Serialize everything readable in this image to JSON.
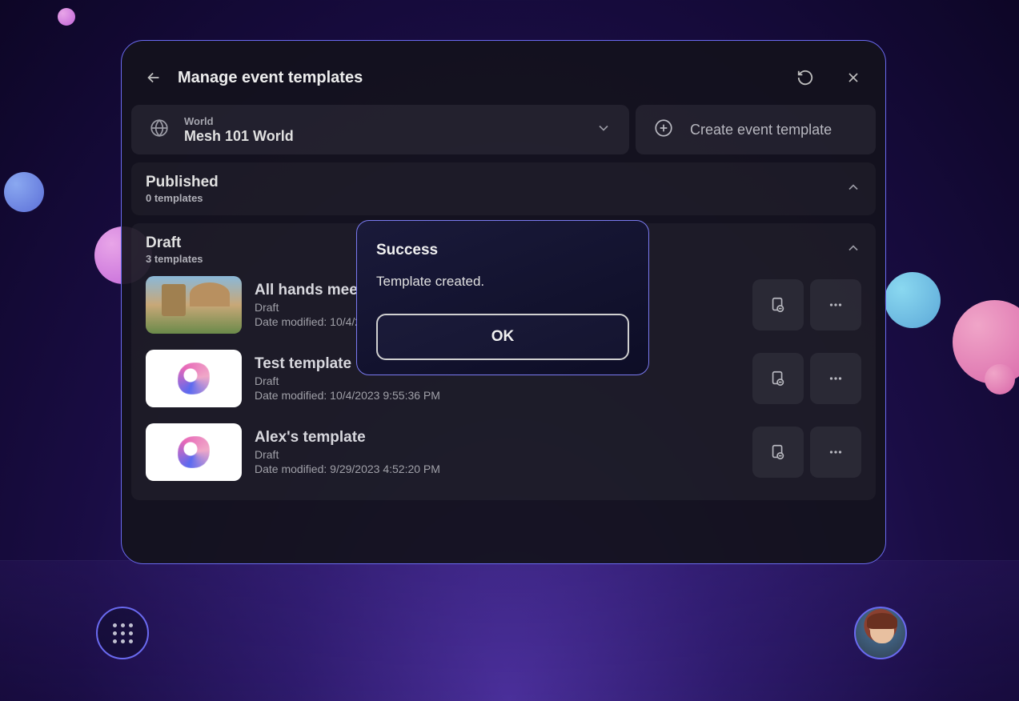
{
  "header": {
    "title": "Manage event templates"
  },
  "world": {
    "label": "World",
    "value": "Mesh 101 World"
  },
  "create_button": "Create event template",
  "sections": {
    "published": {
      "title": "Published",
      "count": "0 templates"
    },
    "draft": {
      "title": "Draft",
      "count": "3 templates"
    }
  },
  "templates": [
    {
      "name": "All hands meeting",
      "status": "Draft",
      "modified": "Date modified: 10/4/20"
    },
    {
      "name": "Test template",
      "status": "Draft",
      "modified": "Date modified: 10/4/2023 9:55:36 PM"
    },
    {
      "name": "Alex's template",
      "status": "Draft",
      "modified": "Date modified: 9/29/2023 4:52:20 PM"
    }
  ],
  "modal": {
    "title": "Success",
    "message": "Template created.",
    "ok": "OK"
  }
}
